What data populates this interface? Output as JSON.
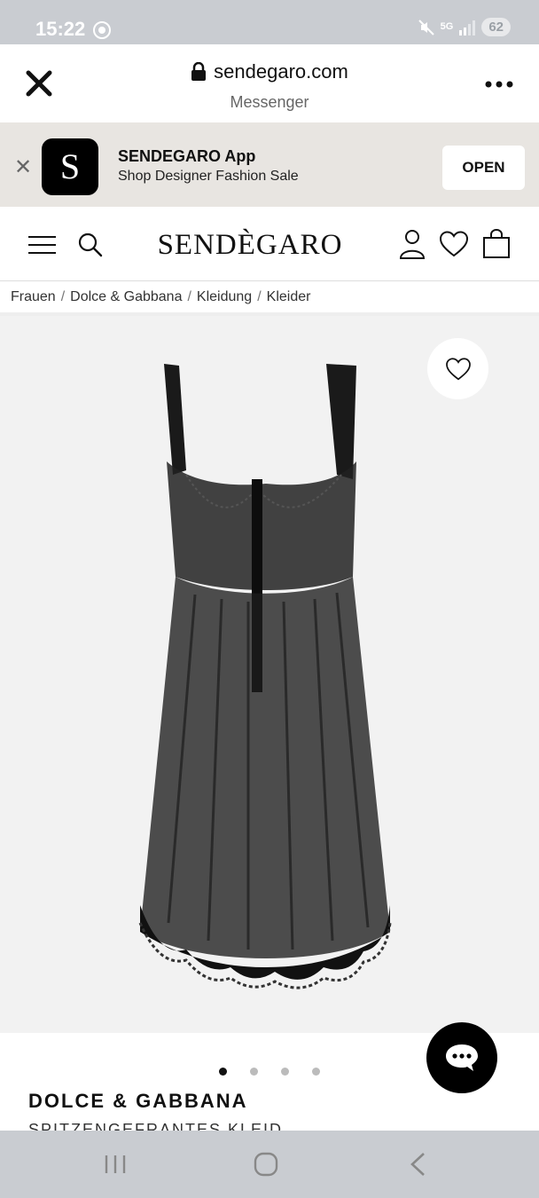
{
  "status_bar": {
    "time": "15:22",
    "network": "5G",
    "battery": "62"
  },
  "browser": {
    "domain": "sendegaro.com",
    "source": "Messenger"
  },
  "app_banner": {
    "logo_letter": "S",
    "title": "SENDEGARO App",
    "subtitle": "Shop Designer Fashion Sale",
    "open_label": "OPEN"
  },
  "header": {
    "logo": "SENDÈGARO"
  },
  "breadcrumb": {
    "items": [
      "Frauen",
      "Dolce & Gabbana",
      "Kleidung",
      "Kleider"
    ],
    "separator": "/"
  },
  "product": {
    "brand": "DOLCE & GABBANA",
    "name": "SPITZENGEFRANTES KLEID",
    "image_count": 4,
    "active_image": 1
  },
  "icons": {
    "close": "close-icon",
    "lock": "lock-icon",
    "more": "more-icon",
    "menu": "menu-icon",
    "search": "search-icon",
    "user": "user-icon",
    "wishlist": "heart-icon",
    "bag": "bag-icon",
    "chat": "chat-icon"
  },
  "colors": {
    "accent": "#000000",
    "banner_bg": "#e8e5e1",
    "image_bg": "#f2f2f2",
    "system_bar": "#c9ccd1"
  }
}
